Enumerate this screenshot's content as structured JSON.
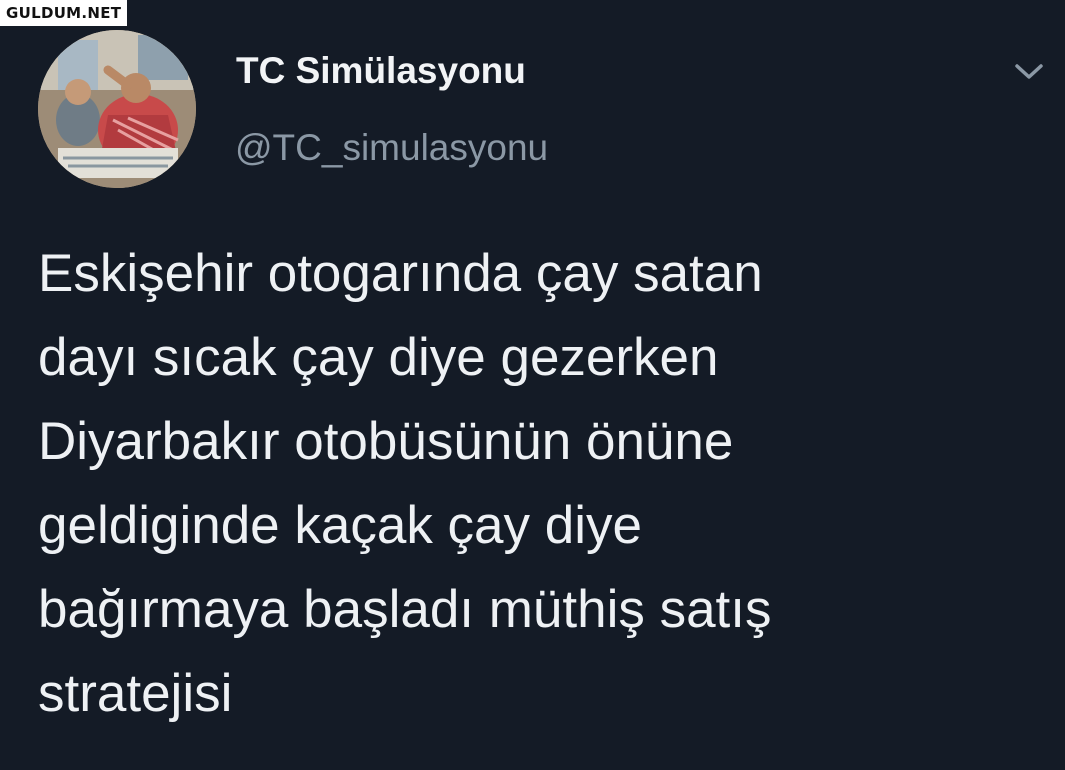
{
  "watermark": "GULDUM.NET",
  "tweet": {
    "display_name": "TC Simülasyonu",
    "handle": "@TC_simulasyonu",
    "text_lines": [
      "Eskişehir otogarında çay satan",
      "dayı sıcak çay diye gezerken",
      "Diyarbakır otobüsünün önüne",
      "geldiginde kaçak çay diye",
      "bağırmaya başladı müthiş satış",
      "stratejisi"
    ],
    "avatar_icon": "profile-photo",
    "menu_icon": "chevron-down-icon"
  },
  "colors": {
    "background": "#141b26",
    "primary_text": "#eef1f4",
    "secondary_text": "#8b98a5"
  }
}
